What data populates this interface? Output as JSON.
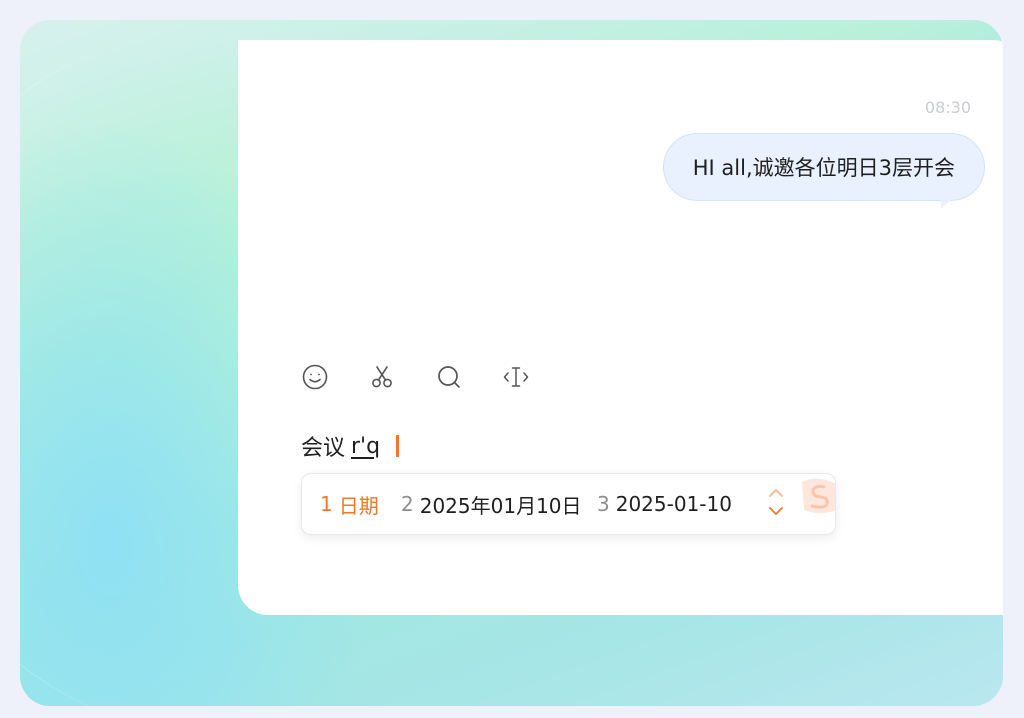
{
  "chat": {
    "time": "08:30",
    "message": "HI all,诚邀各位明日3层开会"
  },
  "toolbar": {
    "items": [
      {
        "icon": "emoji-icon"
      },
      {
        "icon": "scissors-icon"
      },
      {
        "icon": "search-icon"
      },
      {
        "icon": "text-cursor-icon"
      }
    ]
  },
  "compose": {
    "committed": "会议",
    "pinyin": "r'q"
  },
  "candidates": [
    {
      "num": "1",
      "text": "日期"
    },
    {
      "num": "2",
      "text": "2025年01月10日"
    },
    {
      "num": "3",
      "text": "2025-01-10"
    }
  ],
  "colors": {
    "accent": "#f2772b",
    "bubble": "#e8f1fd",
    "time": "#c9ccd3"
  }
}
